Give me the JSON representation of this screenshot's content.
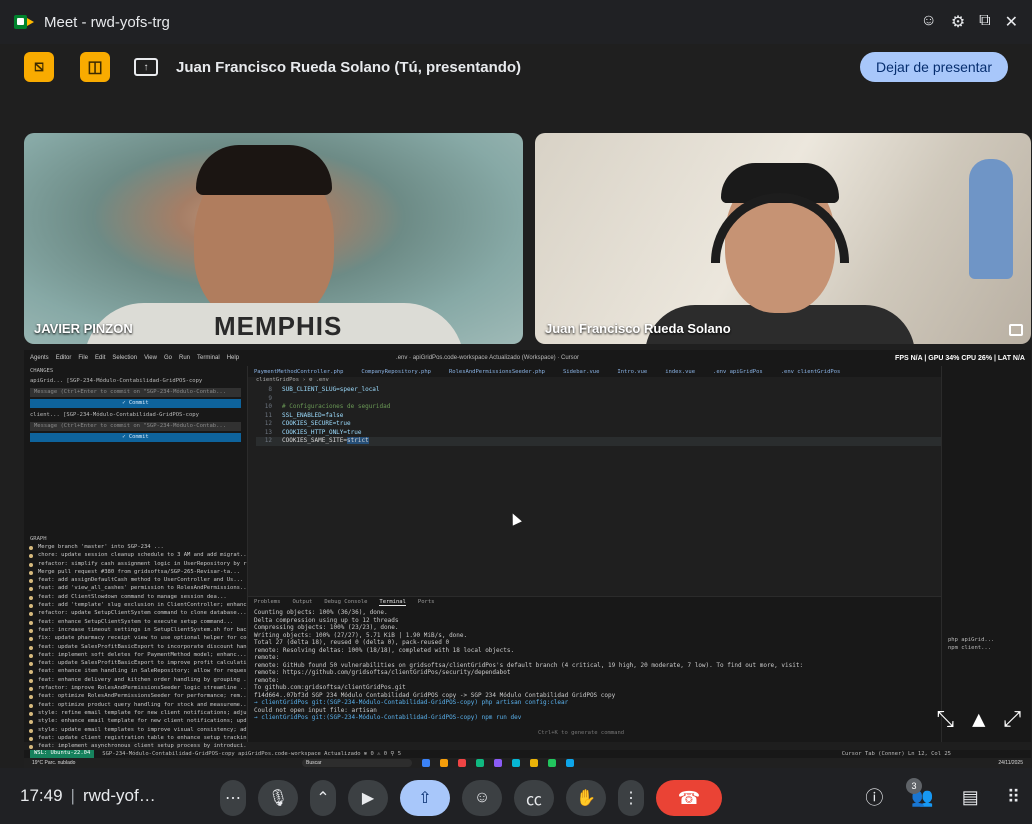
{
  "window": {
    "title": "Meet - rwd-yofs-trg",
    "controls": [
      "☺",
      "⚙",
      "⧉",
      "✕"
    ]
  },
  "presenting": {
    "banner": "Juan Francisco Rueda Solano (Tú, presentando)",
    "stop_label": "Dejar de presentar"
  },
  "participants": [
    {
      "name": "JAVIER PINZON",
      "shirt_text": "MEMPHIS"
    },
    {
      "name": "Juan Francisco Rueda Solano"
    }
  ],
  "shared_screen": {
    "top_menu": [
      "Agents",
      "Editor",
      "File",
      "Edit",
      "Selection",
      "View",
      "Go",
      "Run",
      "Terminal",
      "Help"
    ],
    "window_title": ".env · apiGridPos.code-workspace Actualizado (Workspace) · Cursor",
    "perf": "FPS N/A | GPU 34% CPU 26% | LAT N/A",
    "changes_header": "CHANGES",
    "repos": [
      {
        "name": "apiGrid... [SGP-234-Módulo-Contabilidad-GridPOS-copy",
        "message_placeholder": "Message (Ctrl+Enter to commit on \"SGP-234-Módulo-Contab...",
        "commit_label": "✓ Commit"
      },
      {
        "name": "client... [SGP-234-Módulo-Contabilidad-GridPOS-copy",
        "message_placeholder": "Message (Ctrl+Enter to commit on \"SGP-234-Módulo-Contab...",
        "commit_label": "✓ Commit"
      }
    ],
    "graph_header": "GRAPH",
    "graph": [
      "Merge branch 'master' into SGP-234 ...",
      "chore: update session cleanup schedule to 3 AM and add migrat...",
      "refactor: simplify cash assignment logic in UserRepository by re...",
      "Merge pull request #380 from gridsoftsa/SGP-265-Revisar-ta...",
      "feat: add assignDefaultCash method to UserController and Us...",
      "feat: add 'view_all_cashes' permission to RolesAndPermissions...",
      "feat: add ClientSlowdown command to manage session dea...",
      "feat: add 'template' slug exclusion in ClientController; enhanc...",
      "refactor: update SetupClientSystem command to clone database...",
      "feat: enhance SetupClientSystem to execute setup command...",
      "feat: increase timeout settings in SetupClientSystem.sh for bac...",
      "fix: update pharmacy receipt view to use optional helper for co...",
      "feat: update SalesProfitBasicExport to incorporate discount hand...",
      "feat: implement soft deletes for PaymentMethod model; enhanc...",
      "feat: update SalesProfitBasicExport to improve profit calculation...",
      "feat: enhance item handling in SaleRepository; allow for request ...",
      "feat: enhance delivery and kitchen order handling by grouping ...",
      "refactor: improve RolesAndPermissionsSeeder logic streamline ...",
      "feat: optimize RolesAndPermissionsSeeder for performance; rem...",
      "feat: optimize product query handling for stock and measureme...",
      "style: refine email template for new client notifications; adjust pa...",
      "style: enhance email template for new client notifications; updat...",
      "style: update email templates to improve visual consistency; adj...",
      "feat: update client registration table to enhance setup tracking...",
      "feat: implement asynchronous client setup process by introduci..."
    ],
    "tabs": [
      "PaymentMethodController.php",
      "CompanyRepository.php",
      "RolesAndPermissionsSeeder.php",
      "Sidebar.vue",
      "Intro.vue",
      "index.vue",
      ".env apiGridPos",
      ".env clientGridPos"
    ],
    "breadcrumb": "clientGridPos › ⚙ .env",
    "code": [
      {
        "n": "8",
        "text": "SUB_CLIENT_SLUG=speer_local",
        "style": "plain"
      },
      {
        "n": "9",
        "text": "",
        "style": "plain"
      },
      {
        "n": "10",
        "text": "# Configuraciones de seguridad",
        "style": "cmt"
      },
      {
        "n": "11",
        "text": "SSL_ENABLED=false",
        "style": "plain"
      },
      {
        "n": "12",
        "text": "COOKIES_SECURE=true",
        "style": "plain"
      },
      {
        "n": "13",
        "text": "COOKIES_HTTP_ONLY=true",
        "style": "plain"
      }
    ],
    "current_line": {
      "n": "12",
      "text": "COOKIES_SAME_SITE=",
      "selected": "strict"
    },
    "panel_tabs": [
      "Problems",
      "Output",
      "Debug Console",
      "Terminal",
      "Ports"
    ],
    "terminal": [
      "Counting objects: 100% (36/36), done.",
      "Delta compression using up to 12 threads",
      "Compressing objects: 100% (23/23), done.",
      "Writing objects: 100% (27/27), 5.71 KiB | 1.90 MiB/s, done.",
      "Total 27 (delta 18), reused 0 (delta 0), pack-reused 0",
      "remote: Resolving deltas: 100% (18/18), completed with 18 local objects.",
      "remote:",
      "remote: GitHub found 50 vulnerabilities on gridsoftsa/clientGridPos's default branch (4 critical, 19 high, 20 moderate, 7 low). To find out more, visit:",
      "remote:      https://github.com/gridsoftsa/clientGridPos/security/dependabot",
      "remote:",
      "To github.com:gridsoftsa/clientGridPos.git",
      "   f14d664..07bf3d  SGP 234 Módulo Contabilidad GridPOS copy -> SGP 234 Módulo Contabilidad GridPOS copy"
    ],
    "prompts": [
      "→ clientGridPos git:(SGP-234-Módulo-Contabilidad-GridPOS-copy) php artisan config:clear",
      "Could not open input file: artisan",
      "→ clientGridPos git:(SGP-234-Módulo-Contabilidad-GridPOS-copy) npm run dev"
    ],
    "hint": "Ctrl+K to generate command",
    "processes": [
      "php apiGrid...",
      "npm client..."
    ],
    "status_left": "WSL: Ubuntu-22.04",
    "status_text": "SGP-234-Módulo-Contabilidad-GridPOS-copy   apiGridPos.code-workspace Actualizado   ⊗ 0 ⚠ 0   ⚲ 5",
    "status_right": "Cursor Tab (Conner)   Ln 12, Col 25",
    "taskbar": {
      "weather": "19°C Parc. nublado",
      "search": "Buscar",
      "clock": "24/11/2025"
    }
  },
  "bottom": {
    "time": "17:49",
    "meeting": "rwd-yof…",
    "participants_count": "3"
  }
}
